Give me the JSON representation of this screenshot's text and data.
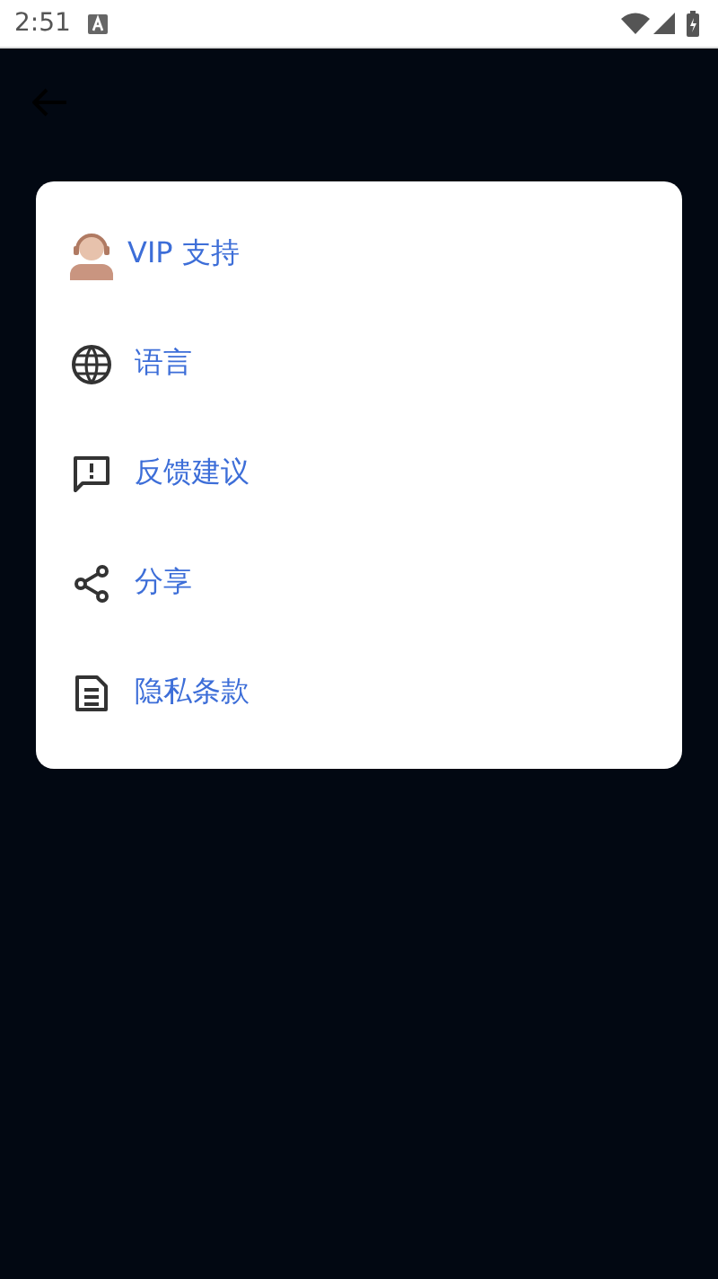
{
  "status_bar": {
    "time": "2:51"
  },
  "menu": {
    "items": [
      {
        "kind": "support",
        "label": "VIP 支持"
      },
      {
        "kind": "globe",
        "label": "语言"
      },
      {
        "kind": "feedback",
        "label": "反馈建议"
      },
      {
        "kind": "share",
        "label": "分享"
      },
      {
        "kind": "document",
        "label": "隐私条款"
      }
    ]
  }
}
